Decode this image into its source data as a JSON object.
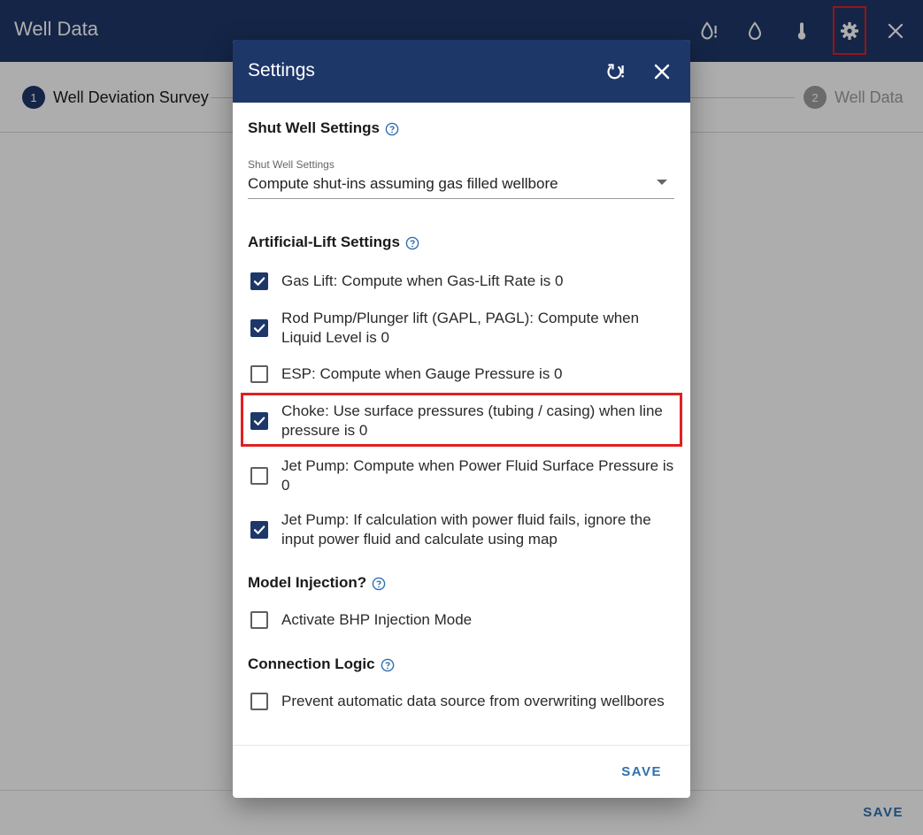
{
  "app": {
    "title": "Well Data",
    "header_icons": [
      "drop-alert-icon",
      "drop-icon",
      "thermometer-icon",
      "gear-icon",
      "close-icon"
    ]
  },
  "stepper": {
    "steps": [
      {
        "number": "1",
        "label": "Well Deviation Survey",
        "state": "active"
      },
      {
        "number": "2",
        "label": "Well Data",
        "state": "inactive"
      }
    ]
  },
  "footer": {
    "save_label": "SAVE"
  },
  "dialog": {
    "title": "Settings",
    "header_icons": [
      "reset-alert-icon",
      "close-icon"
    ],
    "shut_well": {
      "title": "Shut Well Settings",
      "select_label": "Shut Well Settings",
      "select_value": "Compute shut-ins assuming gas filled wellbore"
    },
    "artificial_lift": {
      "title": "Artificial-Lift Settings",
      "options": [
        {
          "label": "Gas Lift: Compute when Gas-Lift Rate is 0",
          "checked": true
        },
        {
          "label": "Rod Pump/Plunger lift (GAPL, PAGL): Compute when Liquid Level is 0",
          "checked": true
        },
        {
          "label": "ESP: Compute when Gauge Pressure is 0",
          "checked": false
        },
        {
          "label": "Choke: Use surface pressures (tubing / casing) when line pressure is 0",
          "checked": true
        },
        {
          "label": "Jet Pump: Compute when Power Fluid Surface Pressure is 0",
          "checked": false
        },
        {
          "label": "Jet Pump: If calculation with power fluid fails, ignore the input power fluid and calculate using map",
          "checked": true
        }
      ]
    },
    "model_injection": {
      "title": "Model Injection?",
      "options": [
        {
          "label": "Activate BHP Injection Mode",
          "checked": false
        }
      ]
    },
    "connection_logic": {
      "title": "Connection Logic",
      "options": [
        {
          "label": "Prevent automatic data source from overwriting wellbores",
          "checked": false
        }
      ]
    },
    "save_label": "SAVE"
  },
  "colors": {
    "header_bg": "#1e3769",
    "accent_blue": "#2f6fb0",
    "highlight_red": "#e02020",
    "inactive_step": "#9e9e9e"
  }
}
